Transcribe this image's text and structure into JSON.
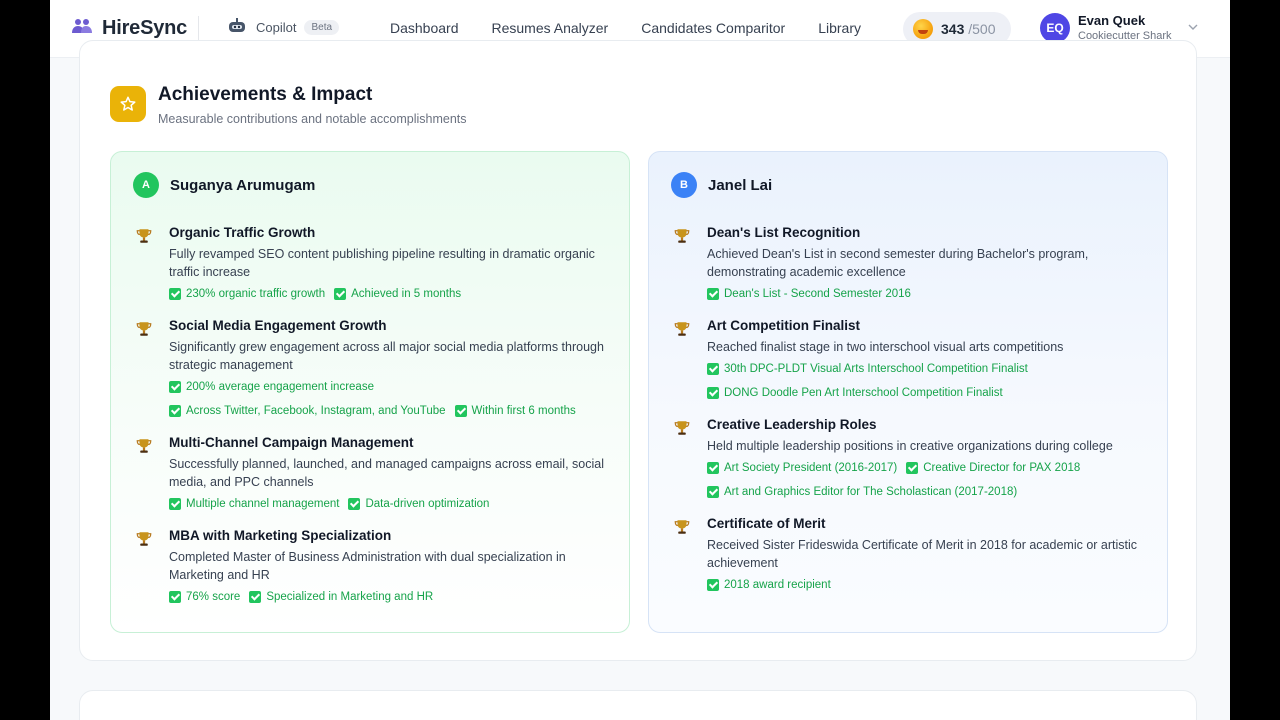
{
  "header": {
    "brand": "HireSync",
    "copilot_label": "Copilot",
    "beta_label": "Beta",
    "nav": [
      "Dashboard",
      "Resumes Analyzer",
      "Candidates Comparitor",
      "Library"
    ],
    "credits_used": "343",
    "credits_total": "/500",
    "user_initials": "EQ",
    "user_name": "Evan Quek",
    "user_role": "Cookiecutter Shark"
  },
  "section": {
    "title": "Achievements & Impact",
    "subtitle": "Measurable contributions and notable accomplishments",
    "accent_color": "#eab308"
  },
  "candidates": [
    {
      "badge": "A",
      "name": "Suganya Arumugam",
      "color": "#22c55e",
      "achievements": [
        {
          "title": "Organic Traffic Growth",
          "description": "Fully revamped SEO content publishing pipeline resulting in dramatic organic traffic increase",
          "tags": [
            "230% organic traffic growth",
            "Achieved in 5 months"
          ]
        },
        {
          "title": "Social Media Engagement Growth",
          "description": "Significantly grew engagement across all major social media platforms through strategic management",
          "tags": [
            "200% average engagement increase",
            "Across Twitter, Facebook, Instagram, and YouTube",
            "Within first 6 months"
          ]
        },
        {
          "title": "Multi-Channel Campaign Management",
          "description": "Successfully planned, launched, and managed campaigns across email, social media, and PPC channels",
          "tags": [
            "Multiple channel management",
            "Data-driven optimization"
          ]
        },
        {
          "title": "MBA with Marketing Specialization",
          "description": "Completed Master of Business Administration with dual specialization in Marketing and HR",
          "tags": [
            "76% score",
            "Specialized in Marketing and HR"
          ]
        }
      ]
    },
    {
      "badge": "B",
      "name": "Janel Lai",
      "color": "#3b82f6",
      "achievements": [
        {
          "title": "Dean's List Recognition",
          "description": "Achieved Dean's List in second semester during Bachelor's program, demonstrating academic excellence",
          "tags": [
            "Dean's List - Second Semester 2016"
          ]
        },
        {
          "title": "Art Competition Finalist",
          "description": "Reached finalist stage in two interschool visual arts competitions",
          "tags": [
            "30th DPC-PLDT Visual Arts Interschool Competition Finalist",
            "DONG Doodle Pen Art Interschool Competition Finalist"
          ]
        },
        {
          "title": "Creative Leadership Roles",
          "description": "Held multiple leadership positions in creative organizations during college",
          "tags": [
            "Art Society President (2016-2017)",
            "Creative Director for PAX 2018",
            "Art and Graphics Editor for The Scholastican (2017-2018)"
          ]
        },
        {
          "title": "Certificate of Merit",
          "description": "Received Sister Frideswida Certificate of Merit in 2018 for academic or artistic achievement",
          "tags": [
            "2018 award recipient"
          ]
        }
      ]
    }
  ]
}
